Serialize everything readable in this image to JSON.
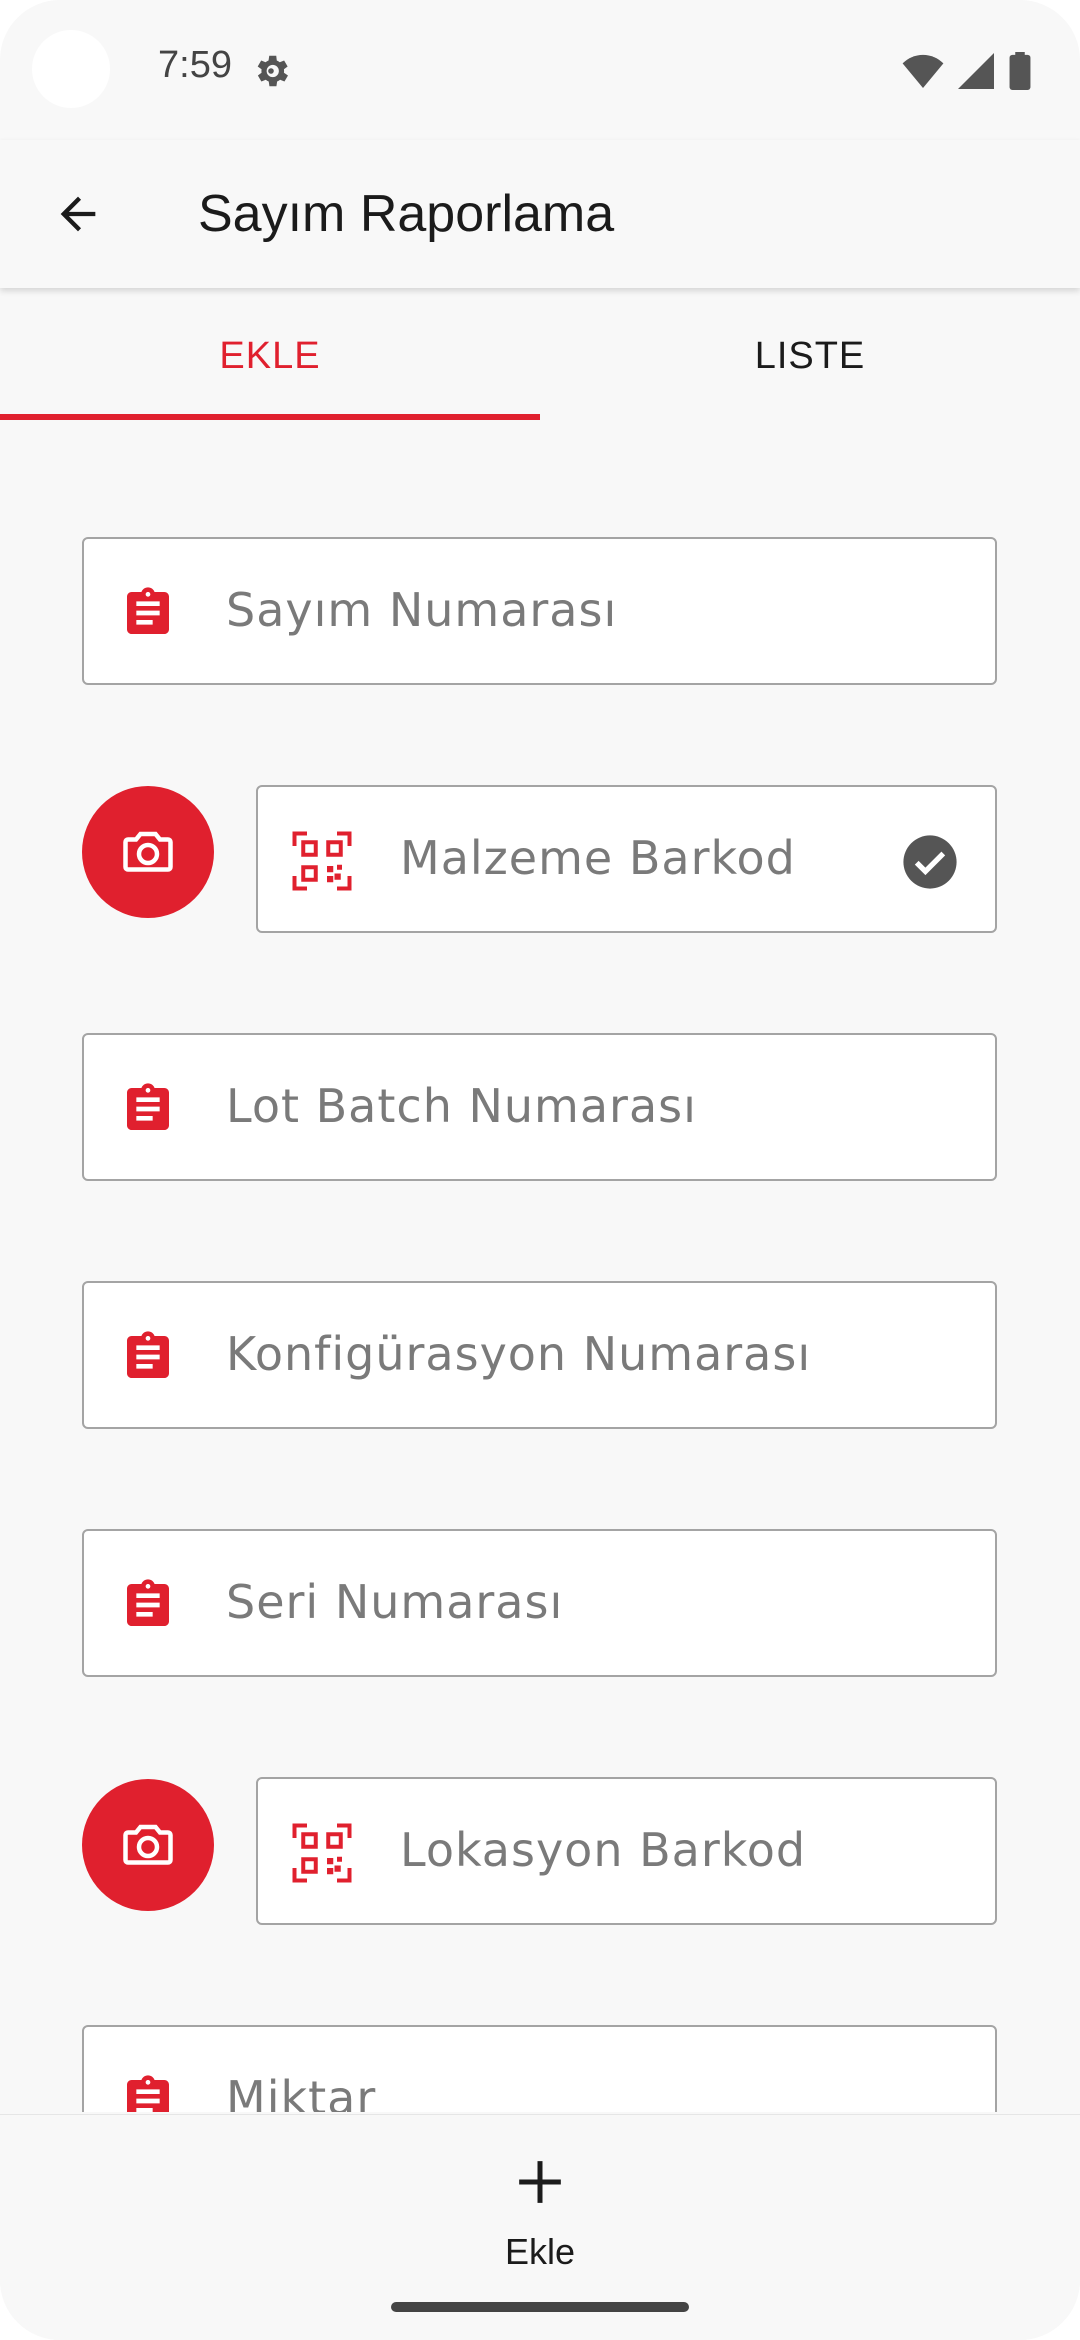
{
  "status_bar": {
    "time": "7:59"
  },
  "app_bar": {
    "title": "Sayım Raporlama"
  },
  "tabs": [
    {
      "label": "EKLE",
      "selected": true
    },
    {
      "label": "LISTE",
      "selected": false
    }
  ],
  "form": {
    "sayim_numarasi": {
      "placeholder": "Sayım Numarası",
      "icon": "clipboard-icon"
    },
    "malzeme_barkod": {
      "placeholder": "Malzeme Barkod",
      "icon": "qr-code-icon",
      "verified": true
    },
    "lot_batch_numarasi": {
      "placeholder": "Lot Batch Numarası",
      "icon": "clipboard-icon"
    },
    "konfigurasyon_numarasi": {
      "placeholder": "Konfigürasyon Numarası",
      "icon": "clipboard-icon"
    },
    "seri_numarasi": {
      "placeholder": "Seri Numarası",
      "icon": "clipboard-icon"
    },
    "lokasyon_barkod": {
      "placeholder": "Lokasyon Barkod",
      "icon": "qr-code-icon"
    },
    "miktar": {
      "placeholder": "Miktar",
      "icon": "clipboard-icon"
    }
  },
  "bottom_nav": {
    "add_label": "Ekle",
    "icon": "plus-icon"
  },
  "colors": {
    "accent": "#e0202e",
    "background": "#f8f8f8",
    "text": "#1b1b1b",
    "placeholder": "#7a7a7a"
  }
}
